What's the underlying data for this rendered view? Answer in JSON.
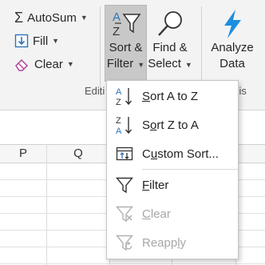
{
  "ribbon": {
    "autosum_label": "AutoSum",
    "fill_label": "Fill",
    "clear_label": "Clear",
    "sort_filter_line1": "Sort &",
    "sort_filter_line2": "Filter",
    "find_select_line1": "Find &",
    "select_line2": "Select",
    "analyze_line1": "Analyze",
    "analyze_line2": "Data",
    "group_editing": "Editi",
    "group_analysis": "sis",
    "accent_color": "#1b8ee0"
  },
  "grid": {
    "columns": [
      "P",
      "Q"
    ]
  },
  "sort_menu": {
    "items": [
      {
        "label_pre": "",
        "label_ul": "S",
        "label_post": "ort A to Z",
        "icon": "sort-a-to-z-icon",
        "enabled": true
      },
      {
        "label_pre": "S",
        "label_ul": "o",
        "label_post": "rt Z to A",
        "icon": "sort-z-to-a-icon",
        "enabled": true
      },
      {
        "label_pre": "C",
        "label_ul": "u",
        "label_post": "stom Sort...",
        "icon": "custom-sort-icon",
        "enabled": true
      },
      {
        "label_pre": "",
        "label_ul": "F",
        "label_post": "ilter",
        "icon": "filter-icon",
        "enabled": true
      },
      {
        "label_pre": "",
        "label_ul": "C",
        "label_post": "lear",
        "icon": "clear-filter-icon",
        "enabled": false
      },
      {
        "label_pre": "Reapp",
        "label_ul": "l",
        "label_post": "y",
        "icon": "reapply-icon",
        "enabled": false
      }
    ]
  }
}
